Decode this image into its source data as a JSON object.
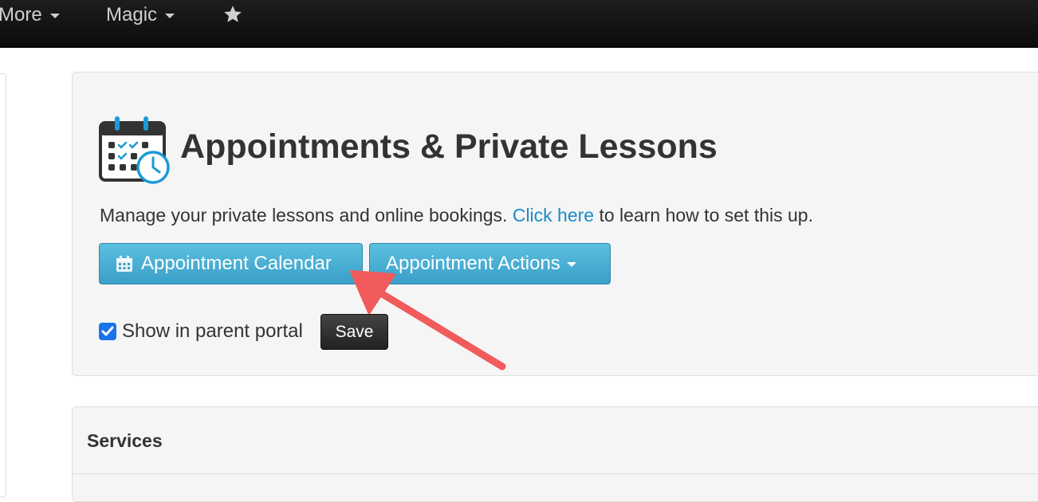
{
  "nav": {
    "items": [
      {
        "label": "More"
      },
      {
        "label": "Magic"
      }
    ],
    "star_icon": "star-icon"
  },
  "appointments": {
    "title": "Appointments & Private Lessons",
    "description_before": "Manage your private lessons and online bookings.",
    "link_text": "Click here",
    "description_after": "to learn how to set this up.",
    "calendar_button": "Appointment Calendar",
    "actions_button": "Appointment Actions",
    "checkbox_label": "Show in parent portal",
    "checkbox_checked": true,
    "save_button": "Save"
  },
  "services": {
    "title": "Services"
  },
  "colors": {
    "accent_blue": "#3a9fc8",
    "link_blue": "#1a8bc7",
    "annotation_arrow": "#f15b5b"
  }
}
